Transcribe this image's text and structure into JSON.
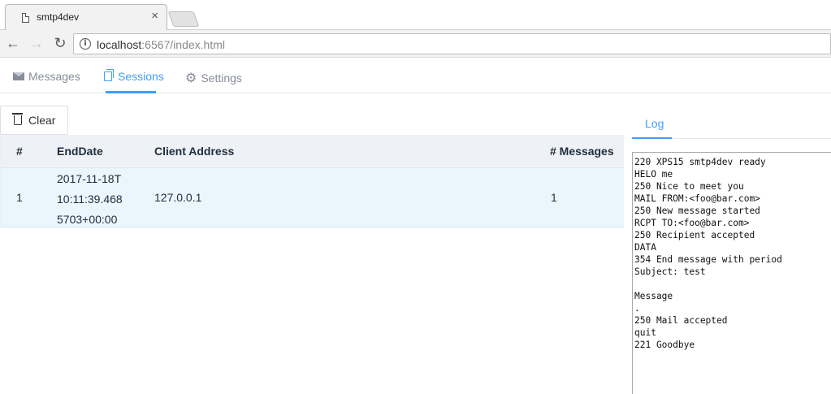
{
  "browser": {
    "tab_title": "smtp4dev",
    "tab_close": "×",
    "url_host": "localhost",
    "url_path": ":6567/index.html",
    "back_icon": "←",
    "forward_icon": "→",
    "reload_icon": "↻"
  },
  "nav": {
    "messages": "Messages",
    "sessions": "Sessions",
    "settings": "Settings",
    "active": "sessions",
    "accent_color": "#409eff"
  },
  "toolbar": {
    "clear_label": "Clear"
  },
  "table": {
    "headers": [
      "#",
      "EndDate",
      "Client Address",
      "# Messages"
    ],
    "rows": [
      {
        "index": "1",
        "end_date_lines": [
          "2017-11-18T",
          "10:11:39.468",
          "5703+00:00"
        ],
        "client_address": "127.0.0.1",
        "messages": "1"
      }
    ]
  },
  "log": {
    "tab_label": "Log",
    "lines": [
      "220 XPS15 smtp4dev ready",
      "HELO me",
      "250 Nice to meet you",
      "MAIL FROM:<foo@bar.com>",
      "250 New message started",
      "RCPT TO:<foo@bar.com>",
      "250 Recipient accepted",
      "DATA",
      "354 End message with period",
      "Subject: test",
      "",
      "Message",
      ".",
      "250 Mail accepted",
      "quit",
      "221 Goodbye"
    ]
  }
}
